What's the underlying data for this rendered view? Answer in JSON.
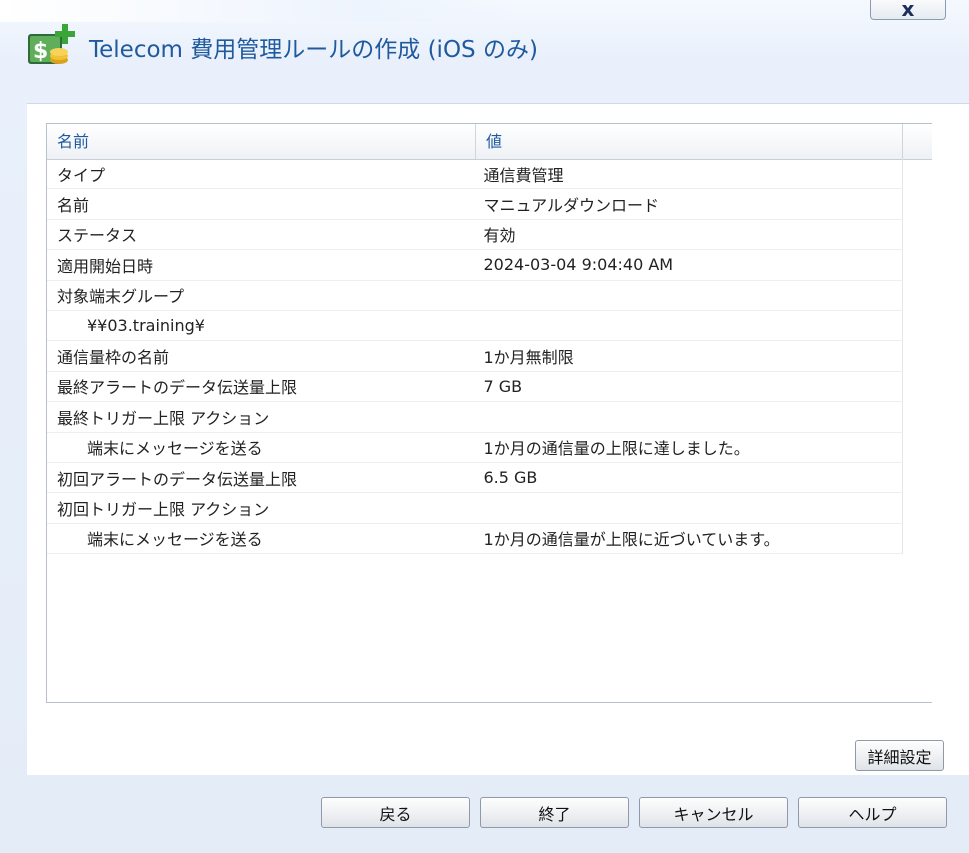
{
  "window": {
    "title": "Telecom 費用管理ルールの作成 (iOS のみ)",
    "close_label": "x",
    "icon": "telecom-cost-add-icon"
  },
  "table": {
    "columns": [
      "名前",
      "値"
    ],
    "rows": [
      {
        "name": "タイプ",
        "value": "通信費管理",
        "indent": false
      },
      {
        "name": "名前",
        "value": "マニュアルダウンロード",
        "indent": false
      },
      {
        "name": "ステータス",
        "value": "有効",
        "indent": false
      },
      {
        "name": "適用開始日時",
        "value": "2024-03-04 9:04:40 AM",
        "indent": false
      },
      {
        "name": "対象端末グループ",
        "value": "",
        "indent": false
      },
      {
        "name": "¥¥03.training¥",
        "value": "",
        "indent": true
      },
      {
        "name": "通信量枠の名前",
        "value": "1か月無制限",
        "indent": false
      },
      {
        "name": "最終アラートのデータ伝送量上限",
        "value": "7 GB",
        "indent": false
      },
      {
        "name": "最終トリガー上限 アクション",
        "value": "",
        "indent": false
      },
      {
        "name": "端末にメッセージを送る",
        "value": "1か月の通信量の上限に達しました。",
        "indent": true
      },
      {
        "name": "初回アラートのデータ伝送量上限",
        "value": "6.5 GB",
        "indent": false
      },
      {
        "name": "初回トリガー上限 アクション",
        "value": "",
        "indent": false
      },
      {
        "name": "端末にメッセージを送る",
        "value": "1か月の通信量が上限に近づいています。",
        "indent": true
      }
    ]
  },
  "buttons": {
    "advanced": "詳細設定",
    "back": "戻る",
    "finish": "終了",
    "cancel": "キャンセル",
    "help": "ヘルプ"
  },
  "colors": {
    "title": "#1f5a9e",
    "header_text": "#1f5a9e",
    "background": "#e6eefa"
  }
}
